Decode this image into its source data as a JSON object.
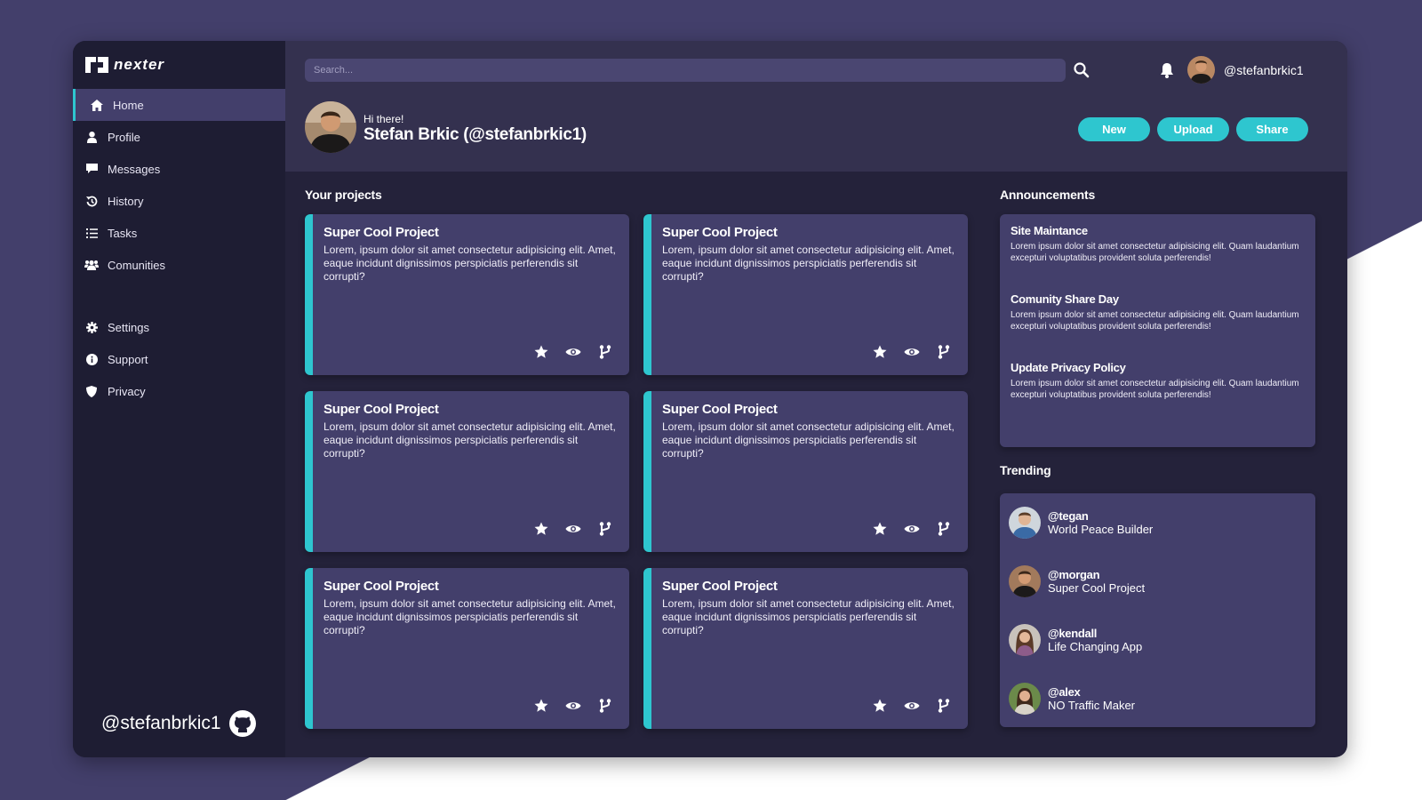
{
  "app": {
    "logo_text": "nexter"
  },
  "sidebar": {
    "items": [
      {
        "label": "Home",
        "icon": "home-icon",
        "active": true
      },
      {
        "label": "Profile",
        "icon": "user-icon"
      },
      {
        "label": "Messages",
        "icon": "message-icon"
      },
      {
        "label": "History",
        "icon": "history-icon"
      },
      {
        "label": "Tasks",
        "icon": "tasks-icon"
      },
      {
        "label": "Comunities",
        "icon": "users-icon"
      }
    ],
    "items2": [
      {
        "label": "Settings",
        "icon": "gear-icon"
      },
      {
        "label": "Support",
        "icon": "info-icon"
      },
      {
        "label": "Privacy",
        "icon": "shield-icon"
      }
    ],
    "footer_handle": "@stefanbrkic1"
  },
  "header": {
    "search_placeholder": "Search...",
    "username": "@stefanbrkic1",
    "greeting": "Hi there!",
    "full_name": "Stefan Brkic (@stefanbrkic1)",
    "buttons": {
      "new": "New",
      "upload": "Upload",
      "share": "Share"
    }
  },
  "colors": {
    "accent": "#2ec6cf",
    "panel": "#433f6b",
    "sidebar": "#1e1d33",
    "header": "#34314f",
    "background": "#24223a"
  },
  "projects": {
    "title": "Your projects",
    "cards": [
      {
        "title": "Super Cool Project",
        "desc": "Lorem, ipsum dolor sit amet consectetur adipisicing elit. Amet, eaque incidunt dignissimos perspiciatis perferendis sit corrupti?"
      },
      {
        "title": "Super Cool Project",
        "desc": "Lorem, ipsum dolor sit amet consectetur adipisicing elit. Amet, eaque incidunt dignissimos perspiciatis perferendis sit corrupti?"
      },
      {
        "title": "Super Cool Project",
        "desc": "Lorem, ipsum dolor sit amet consectetur adipisicing elit. Amet, eaque incidunt dignissimos perspiciatis perferendis sit corrupti?"
      },
      {
        "title": "Super Cool Project",
        "desc": "Lorem, ipsum dolor sit amet consectetur adipisicing elit. Amet, eaque incidunt dignissimos perspiciatis perferendis sit corrupti?"
      },
      {
        "title": "Super Cool Project",
        "desc": "Lorem, ipsum dolor sit amet consectetur adipisicing elit. Amet, eaque incidunt dignissimos perspiciatis perferendis sit corrupti?"
      },
      {
        "title": "Super Cool Project",
        "desc": "Lorem, ipsum dolor sit amet consectetur adipisicing elit. Amet, eaque incidunt dignissimos perspiciatis perferendis sit corrupti?"
      }
    ]
  },
  "announcements": {
    "title": "Announcements",
    "items": [
      {
        "title": "Site Maintance",
        "text": "Lorem ipsum dolor sit amet consectetur adipisicing elit. Quam laudantium excepturi voluptatibus provident soluta perferendis!"
      },
      {
        "title": "Comunity Share Day",
        "text": "Lorem ipsum dolor sit amet consectetur adipisicing elit. Quam laudantium excepturi voluptatibus provident soluta perferendis!"
      },
      {
        "title": "Update Privacy Policy",
        "text": "Lorem ipsum dolor sit amet consectetur adipisicing elit. Quam laudantium excepturi voluptatibus provident soluta perferendis!"
      }
    ]
  },
  "trending": {
    "title": "Trending",
    "items": [
      {
        "handle": "@tegan",
        "project": "World Peace Builder"
      },
      {
        "handle": "@morgan",
        "project": "Super Cool Project"
      },
      {
        "handle": "@kendall",
        "project": "Life Changing App"
      },
      {
        "handle": "@alex",
        "project": "NO Traffic Maker"
      }
    ]
  }
}
